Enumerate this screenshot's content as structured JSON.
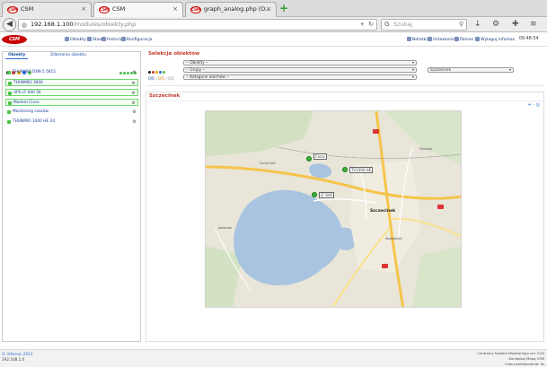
{
  "browser": {
    "tabs": [
      {
        "label": "CSM",
        "favicon": "CSM",
        "active": false
      },
      {
        "label": "CSM",
        "favicon": "CSM",
        "active": true
      },
      {
        "label": "graph_analog.php (O...",
        "favicon": "CSM",
        "active": false
      }
    ],
    "url_host": "192.168.1.100",
    "url_path": "/modules/obiekty.php",
    "search_placeholder": "Szukaj"
  },
  "app": {
    "logo_text": "CSM",
    "menu_left": [
      "Obiekty",
      "Stan",
      "Historia",
      "Konfiguracja"
    ],
    "menu_right": [
      "Notatki",
      "Ustawienia",
      "Pomoc",
      "Wyloguj infomac"
    ],
    "clock": "09:48:54"
  },
  "left_panel": {
    "tabs": [
      "Obiekty",
      "Zdarzenia obiektu"
    ],
    "objects": [
      {
        "label": "THUNMIO DXN-5 5815",
        "highlighted": false
      },
      {
        "label": "THUNMIO 3000",
        "highlighted": true
      },
      {
        "label": "UPS LT 600 56",
        "highlighted": true
      },
      {
        "label": "Modem Cisco",
        "highlighted": true
      },
      {
        "label": "Monitoring czasów",
        "highlighted": false
      },
      {
        "label": "THUNMIO 1000 HE 24",
        "highlighted": false
      }
    ]
  },
  "selection": {
    "title": "Selekcja obiektów",
    "dropdown_objects": "-- Obiekty --",
    "dropdown_groups": "-- Grupy --",
    "dropdown_categories": "-- Kategorie alarmów --",
    "dropdown_city": "Szczecinek",
    "counts": [
      "0/6",
      "0/5",
      "0/1"
    ]
  },
  "map_panel": {
    "title": "Szczecinek",
    "tools": "+ - ◎",
    "labels": {
      "cisco": "Cisco",
      "tv": "TV1000 HE",
      "lt": "LT 600"
    },
    "city_name": "Szczecinek",
    "small_labels": [
      "Szczecinek",
      "Jeziorowo",
      "Parsęcko",
      "Wojewódzki"
    ]
  },
  "footer": {
    "left_line1": "© infomac 2013",
    "left_line2": "192.168.1.0",
    "right_line1": "Centralny System Monitoringu ver 3.00",
    "right_line2": "Zarządzaj Mapą CSM",
    "right_line3": "Czas przetwarzania: 0s"
  },
  "colors": {
    "accent_red": "#c0392b",
    "link_blue": "#1a3aa0",
    "status_green": "#49c149"
  }
}
